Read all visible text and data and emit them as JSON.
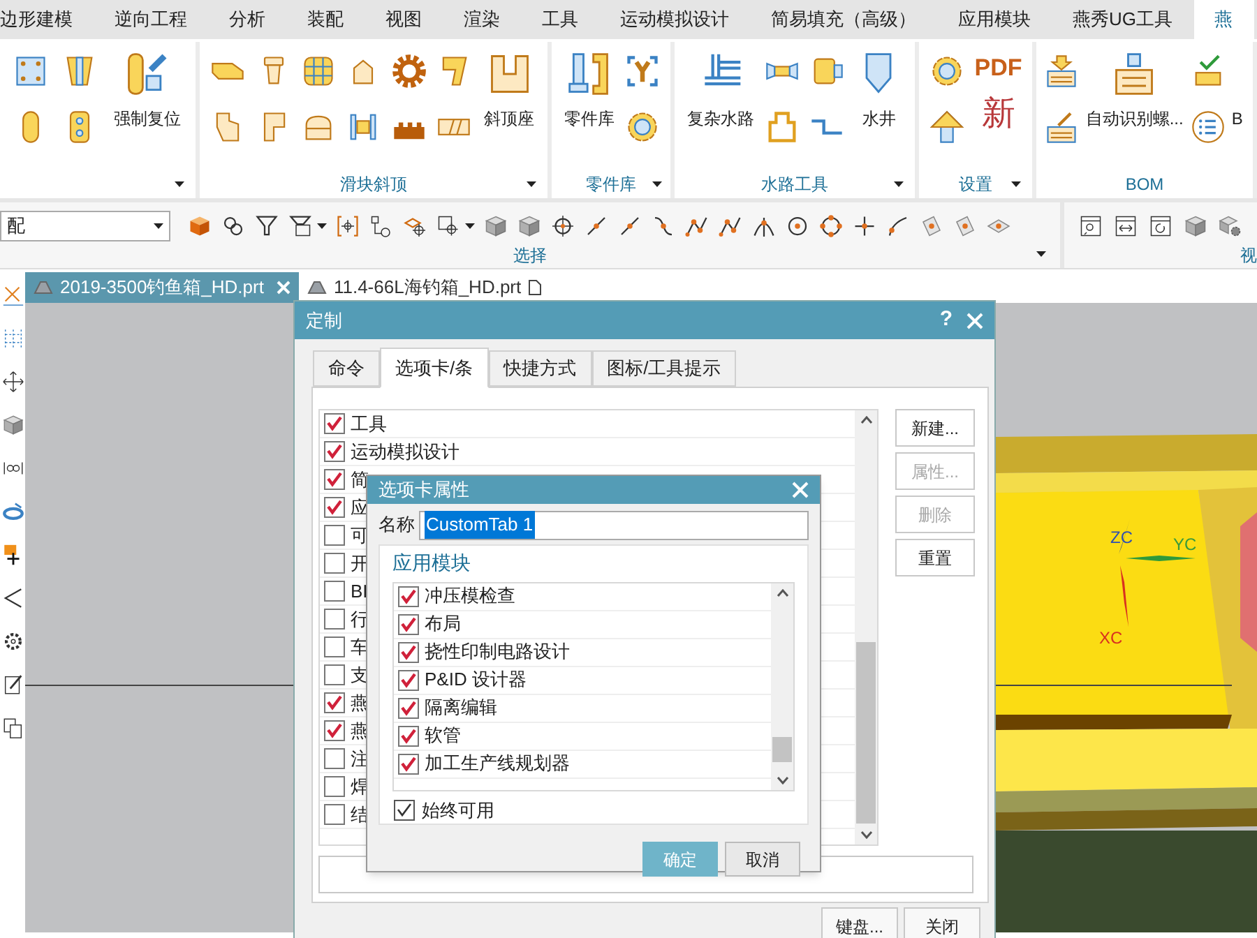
{
  "menu_tabs": [
    {
      "label": "边形建模",
      "selected": false
    },
    {
      "label": "逆向工程",
      "selected": false
    },
    {
      "label": "分析",
      "selected": false
    },
    {
      "label": "装配",
      "selected": false
    },
    {
      "label": "视图",
      "selected": false
    },
    {
      "label": "渲染",
      "selected": false
    },
    {
      "label": "工具",
      "selected": false
    },
    {
      "label": "运动模拟设计",
      "selected": false
    },
    {
      "label": "简易填充（高级）",
      "selected": false
    },
    {
      "label": "应用模块",
      "selected": false
    },
    {
      "label": "燕秀UG工具",
      "selected": false
    },
    {
      "label": "燕",
      "selected": true
    }
  ],
  "ribbon_groups": [
    {
      "buttons": [
        "强制复位"
      ]
    },
    {
      "label": "滑块斜顶",
      "buttons": [
        "斜顶座"
      ]
    },
    {
      "label": "零件库",
      "buttons": [
        "零件库"
      ]
    },
    {
      "label": "水路工具",
      "buttons": [
        "复杂水路",
        "水井"
      ]
    },
    {
      "label": "设置",
      "glyphs": [
        "PDF",
        "新"
      ]
    },
    {
      "label": "BOM",
      "buttons": [
        "自动识别螺...",
        "B"
      ]
    }
  ],
  "selection_bar": {
    "filter_value": "配",
    "label": "选择"
  },
  "view_group": {
    "label": "视"
  },
  "document_tabs": [
    {
      "label": "2019-3500钓鱼箱_HD.prt",
      "selected": true
    },
    {
      "label": "11.4-66L海钓箱_HD.prt",
      "selected": false
    }
  ],
  "viewport": {
    "axis_labels": [
      "ZC",
      "YC",
      "XC"
    ]
  },
  "customize_dialog": {
    "title": "定制",
    "help": "?",
    "tabs": [
      {
        "label": "命令",
        "selected": false
      },
      {
        "label": "选项卡/条",
        "selected": true
      },
      {
        "label": "快捷方式",
        "selected": false
      },
      {
        "label": "图标/工具提示",
        "selected": false
      }
    ],
    "tab_items": [
      {
        "label": "工具",
        "checked": true
      },
      {
        "label": "运动模拟设计",
        "checked": true
      },
      {
        "label": "简",
        "checked": true
      },
      {
        "label": "应",
        "checked": true
      },
      {
        "label": "可",
        "checked": false
      },
      {
        "label": "开",
        "checked": false
      },
      {
        "label": "BI",
        "checked": false
      },
      {
        "label": "行",
        "checked": false
      },
      {
        "label": "车",
        "checked": false
      },
      {
        "label": "支",
        "checked": false
      },
      {
        "label": "燕",
        "checked": true
      },
      {
        "label": "燕",
        "checked": true
      },
      {
        "label": "注",
        "checked": false
      },
      {
        "label": "焊",
        "checked": false
      },
      {
        "label": "结",
        "checked": false
      }
    ],
    "side_buttons": [
      {
        "label": "新建...",
        "disabled": false
      },
      {
        "label": "属性...",
        "disabled": true
      },
      {
        "label": "删除",
        "disabled": true
      },
      {
        "label": "重置",
        "disabled": false
      }
    ],
    "footer_buttons": [
      "键盘...",
      "关闭"
    ]
  },
  "tab_properties_dialog": {
    "title": "选项卡属性",
    "name_label": "名称",
    "name_value": "CustomTab 1",
    "group_label": "应用模块",
    "applications": [
      {
        "label": "冲压模检查",
        "checked": true
      },
      {
        "label": "布局",
        "checked": true
      },
      {
        "label": "挠性印制电路设计",
        "checked": true
      },
      {
        "label": "P&ID 设计器",
        "checked": true
      },
      {
        "label": "隔离编辑",
        "checked": true
      },
      {
        "label": "软管",
        "checked": true
      },
      {
        "label": "加工生产线规划器",
        "checked": true
      }
    ],
    "always_available": {
      "label": "始终可用",
      "checked": true
    },
    "buttons": [
      {
        "label": "确定",
        "kind": "primary"
      },
      {
        "label": "取消",
        "kind": "secondary"
      }
    ]
  }
}
